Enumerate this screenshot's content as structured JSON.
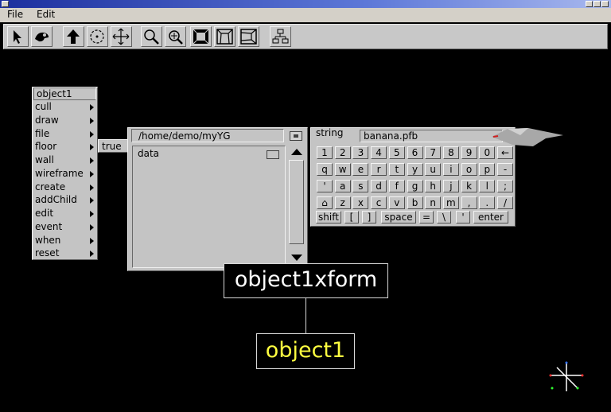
{
  "menubar": {
    "file": "File",
    "edit": "Edit"
  },
  "toolbar": {
    "tools": [
      "select-arrow-icon",
      "fly-icon",
      "move-up-icon",
      "rotate-icon",
      "translate-icon",
      "zoom-icon",
      "zoom-region-icon",
      "view-front-icon",
      "view-top-icon",
      "view-side-icon",
      "scene-graph-icon"
    ]
  },
  "object_menu": {
    "header": "object1",
    "items": [
      "cull",
      "draw",
      "file",
      "floor",
      "wall",
      "wireframe",
      "create",
      "addChild",
      "edit",
      "event",
      "when",
      "reset"
    ],
    "value": "true"
  },
  "file_browser": {
    "path": "/home/demo/myYG",
    "entries": [
      {
        "name": "data",
        "type": "folder"
      }
    ]
  },
  "keyboard": {
    "label": "string",
    "value": "banana.pfb",
    "rows": [
      [
        "1",
        "2",
        "3",
        "4",
        "5",
        "6",
        "7",
        "8",
        "9",
        "0",
        "←"
      ],
      [
        "q",
        "w",
        "e",
        "r",
        "t",
        "y",
        "u",
        "i",
        "o",
        "p",
        "-"
      ],
      [
        "'",
        "a",
        "s",
        "d",
        "f",
        "g",
        "h",
        "j",
        "k",
        "l",
        ";"
      ],
      [
        "⌂",
        "z",
        "x",
        "c",
        "v",
        "b",
        "n",
        "m",
        ",",
        ".",
        "/"
      ]
    ],
    "bottom": [
      "shift",
      "[",
      "]",
      "space",
      "=",
      "\\",
      "'",
      "enter"
    ]
  },
  "scene_graph": {
    "parent": "object1xform",
    "child": "object1"
  },
  "colors": {
    "child_node_text": "#ffff40",
    "parent_node_text": "#ffffff"
  }
}
